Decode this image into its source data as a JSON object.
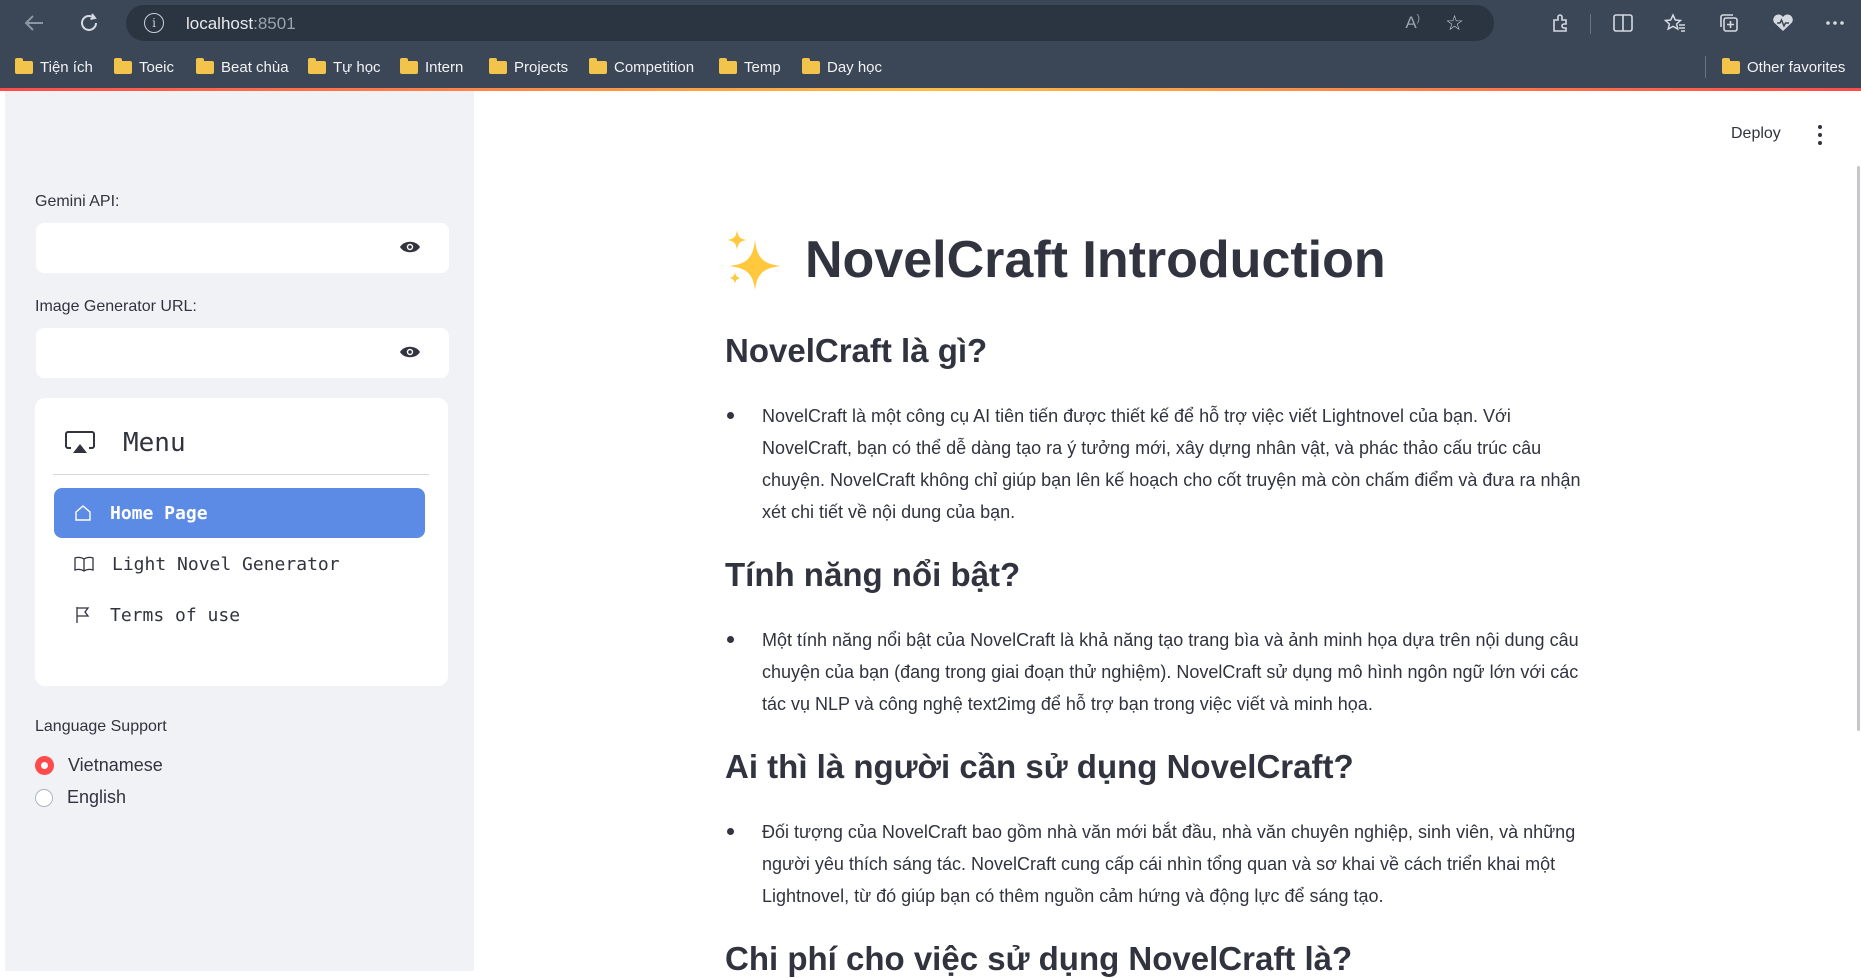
{
  "browser": {
    "url_host": "localhost",
    "url_port": ":8501",
    "bookmarks": [
      "Tiện ích",
      "Toeic",
      "Beat chùa",
      "Tự học",
      "Intern",
      "Projects",
      "Competition",
      "Temp",
      "Day học"
    ],
    "other_favorites": "Other favorites"
  },
  "sidebar": {
    "gemini_label": "Gemini API:",
    "image_url_label": "Image Generator URL:",
    "menu_title": "Menu",
    "menu_items": [
      {
        "label": "Home Page",
        "icon": "house-icon",
        "active": true
      },
      {
        "label": "Light Novel Generator",
        "icon": "book-icon",
        "active": false
      },
      {
        "label": "Terms of use",
        "icon": "flag-icon",
        "active": false
      }
    ],
    "language_label": "Language Support",
    "languages": [
      {
        "label": "Vietnamese",
        "selected": true
      },
      {
        "label": "English",
        "selected": false
      }
    ]
  },
  "header": {
    "deploy_label": "Deploy"
  },
  "main": {
    "title": "NovelCraft Introduction",
    "sections": [
      {
        "heading": "NovelCraft là gì?",
        "text": "NovelCraft là một công cụ AI tiên tiến được thiết kế để hỗ trợ việc viết Lightnovel của bạn. Với NovelCraft, bạn có thể dễ dàng tạo ra ý tưởng mới, xây dựng nhân vật, và phác thảo cấu trúc câu chuyện. NovelCraft không chỉ giúp bạn lên kế hoạch cho cốt truyện mà còn chấm điểm và đưa ra nhận xét chi tiết về nội dung của bạn."
      },
      {
        "heading": "Tính năng nổi bật?",
        "text": "Một tính năng nổi bật của NovelCraft là khả năng tạo trang bìa và ảnh minh họa dựa trên nội dung câu chuyện của bạn (đang trong giai đoạn thử nghiệm). NovelCraft sử dụng mô hình ngôn ngữ lớn với các tác vụ NLP và công nghệ text2img để hỗ trợ bạn trong việc viết và minh họa."
      },
      {
        "heading": "Ai thì là người cần sử dụng NovelCraft?",
        "text": "Đối tượng của NovelCraft bao gồm nhà văn mới bắt đầu, nhà văn chuyên nghiệp, sinh viên, và những người yêu thích sáng tác. NovelCraft cung cấp cái nhìn tổng quan và sơ khai về cách triển khai một Lightnovel, từ đó giúp bạn có thêm nguồn cảm hứng và động lực để sáng tạo."
      },
      {
        "heading": "Chi phí cho việc sử dụng NovelCraft là?",
        "text": ""
      }
    ]
  },
  "colors": {
    "accent": "#ff4b4b",
    "nav_active": "#5c8be6",
    "sidebar_bg": "#f0f2f6",
    "chrome_bg": "#3b4656"
  }
}
